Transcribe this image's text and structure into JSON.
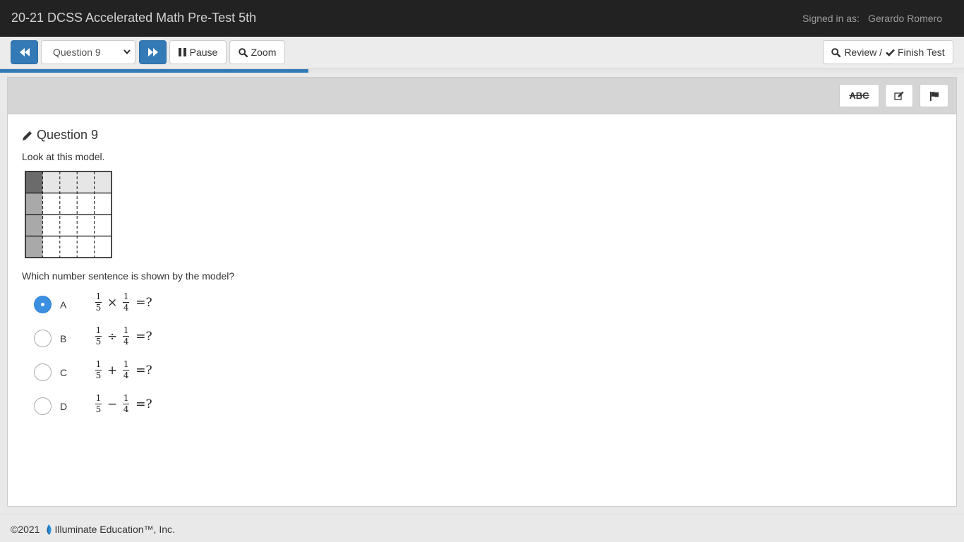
{
  "header": {
    "title": "20-21 DCSS Accelerated Math Pre-Test 5th",
    "signed_in_label": "Signed in as:",
    "user_name": "Gerardo Romero"
  },
  "toolbar": {
    "question_select_value": "Question 9",
    "pause_label": "Pause",
    "zoom_label": "Zoom",
    "review_label": "Review /",
    "finish_label": "Finish Test"
  },
  "progress": {
    "fraction": 0.32
  },
  "tools": {
    "strikethrough_label": "ABC"
  },
  "question": {
    "title": "Question 9",
    "prompt": "Look at this model.",
    "question_text": "Which number sentence is shown by the model?",
    "model": {
      "rows": 4,
      "cols": 5,
      "shaded_col": 1,
      "shaded_row": 1
    },
    "options": [
      {
        "letter": "A",
        "numerator1": "1",
        "denominator1": "5",
        "operator": "×",
        "numerator2": "1",
        "denominator2": "4",
        "tail": "=?",
        "selected": true
      },
      {
        "letter": "B",
        "numerator1": "1",
        "denominator1": "5",
        "operator": "÷",
        "numerator2": "1",
        "denominator2": "4",
        "tail": "=?",
        "selected": false
      },
      {
        "letter": "C",
        "numerator1": "1",
        "denominator1": "5",
        "operator": "+",
        "numerator2": "1",
        "denominator2": "4",
        "tail": "=?",
        "selected": false
      },
      {
        "letter": "D",
        "numerator1": "1",
        "denominator1": "5",
        "operator": "−",
        "numerator2": "1",
        "denominator2": "4",
        "tail": "=?",
        "selected": false
      }
    ]
  },
  "footer": {
    "copyright": "©2021",
    "company": "Illuminate Education™, Inc."
  },
  "colors": {
    "accent": "#337ab7",
    "topbar": "#222222",
    "model_dark": "#6b6b6b",
    "model_mid": "#a9a9a9",
    "model_light": "#e6e6e6"
  }
}
